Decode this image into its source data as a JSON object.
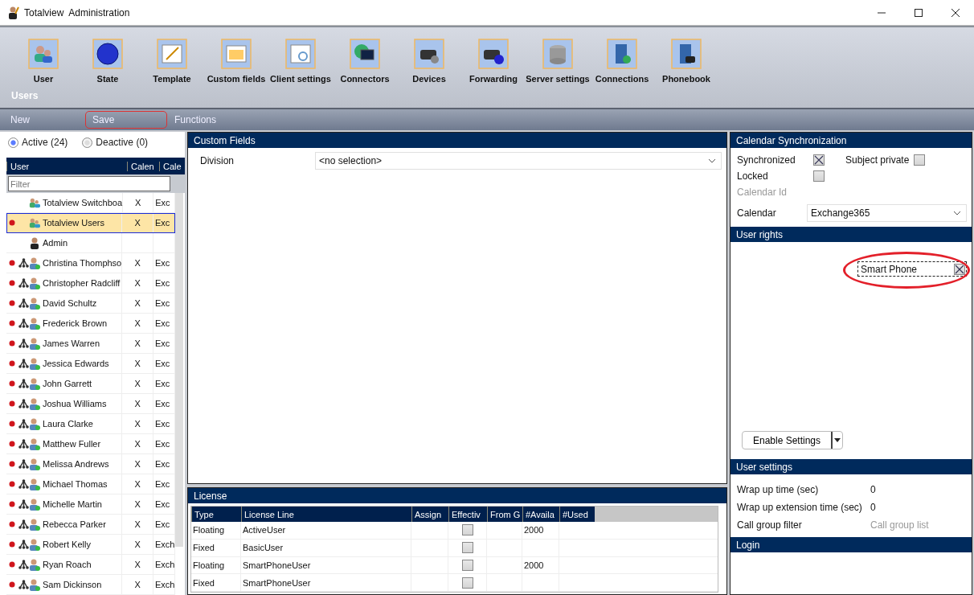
{
  "window": {
    "title": "Totalview  Administration"
  },
  "toolbar": {
    "items": [
      {
        "label": "User"
      },
      {
        "label": "State"
      },
      {
        "label": "Template"
      },
      {
        "label": "Custom fields"
      },
      {
        "label": "Client settings"
      },
      {
        "label": "Connectors"
      },
      {
        "label": "Devices"
      },
      {
        "label": "Forwarding"
      },
      {
        "label": "Server settings"
      },
      {
        "label": "Connections"
      },
      {
        "label": "Phonebook"
      }
    ],
    "section": "Users"
  },
  "commands": [
    {
      "label": "New",
      "annotated": false
    },
    {
      "label": "Save",
      "annotated": true
    },
    {
      "label": "Functions",
      "annotated": false
    }
  ],
  "filter_tabs": [
    {
      "label": "Active (24)",
      "selected": true
    },
    {
      "label": "Deactive (0)",
      "selected": false
    }
  ],
  "user_table": {
    "columns": [
      "User",
      "Calen",
      "Cale"
    ],
    "filter_placeholder": "Filter",
    "rows": [
      {
        "name": "Totalview Switchboa",
        "calendar": "X",
        "column_3": "Exc",
        "dot": false,
        "tree": false,
        "kind": "group",
        "selected": false
      },
      {
        "name": "Totalview Users",
        "calendar": "X",
        "column_3": "Exc",
        "dot": true,
        "tree": false,
        "kind": "group",
        "selected": true
      },
      {
        "name": "Admin",
        "calendar": "",
        "column_3": "",
        "dot": false,
        "tree": false,
        "kind": "admin",
        "selected": false
      },
      {
        "name": "Christina Thomphso",
        "calendar": "X",
        "column_3": "Exc",
        "dot": true,
        "tree": true,
        "kind": "user",
        "selected": false
      },
      {
        "name": "Christopher Radcliff",
        "calendar": "X",
        "column_3": "Exc",
        "dot": true,
        "tree": true,
        "kind": "user",
        "selected": false
      },
      {
        "name": "David Schultz",
        "calendar": "X",
        "column_3": "Exc",
        "dot": true,
        "tree": true,
        "kind": "user",
        "selected": false
      },
      {
        "name": "Frederick Brown",
        "calendar": "X",
        "column_3": "Exc",
        "dot": true,
        "tree": true,
        "kind": "user",
        "selected": false
      },
      {
        "name": "James Warren",
        "calendar": "X",
        "column_3": "Exc",
        "dot": true,
        "tree": true,
        "kind": "user",
        "selected": false
      },
      {
        "name": "Jessica Edwards",
        "calendar": "X",
        "column_3": "Exc",
        "dot": true,
        "tree": true,
        "kind": "user",
        "selected": false
      },
      {
        "name": "John Garrett",
        "calendar": "X",
        "column_3": "Exc",
        "dot": true,
        "tree": true,
        "kind": "user",
        "selected": false
      },
      {
        "name": "Joshua Williams",
        "calendar": "X",
        "column_3": "Exc",
        "dot": true,
        "tree": true,
        "kind": "user",
        "selected": false
      },
      {
        "name": "Laura Clarke",
        "calendar": "X",
        "column_3": "Exc",
        "dot": true,
        "tree": true,
        "kind": "user",
        "selected": false
      },
      {
        "name": "Matthew Fuller",
        "calendar": "X",
        "column_3": "Exc",
        "dot": true,
        "tree": true,
        "kind": "user",
        "selected": false
      },
      {
        "name": "Melissa Andrews",
        "calendar": "X",
        "column_3": "Exc",
        "dot": true,
        "tree": true,
        "kind": "user",
        "selected": false
      },
      {
        "name": "Michael Thomas",
        "calendar": "X",
        "column_3": "Exc",
        "dot": true,
        "tree": true,
        "kind": "user",
        "selected": false
      },
      {
        "name": "Michelle Martin",
        "calendar": "X",
        "column_3": "Exc",
        "dot": true,
        "tree": true,
        "kind": "user",
        "selected": false
      },
      {
        "name": "Rebecca Parker",
        "calendar": "X",
        "column_3": "Exc",
        "dot": true,
        "tree": true,
        "kind": "user",
        "selected": false
      },
      {
        "name": "Robert Kelly",
        "calendar": "X",
        "column_3": "Exch",
        "dot": true,
        "tree": true,
        "kind": "user",
        "selected": false
      },
      {
        "name": "Ryan Roach",
        "calendar": "X",
        "column_3": "Exch",
        "dot": true,
        "tree": true,
        "kind": "user",
        "selected": false
      },
      {
        "name": "Sam Dickinson",
        "calendar": "X",
        "column_3": "Exch",
        "dot": true,
        "tree": true,
        "kind": "user",
        "selected": false
      }
    ]
  },
  "custom_fields": {
    "title": "Custom Fields",
    "fields": [
      {
        "label": "Division",
        "value": "<no selection>"
      }
    ]
  },
  "license": {
    "title": "License",
    "columns": [
      "Type",
      "License Line",
      "Assign",
      "Effectiv",
      "From G",
      "#Availa",
      "#Used"
    ],
    "rows": [
      {
        "type": "Floating",
        "line": "ActiveUser",
        "effective": false,
        "available": "2000"
      },
      {
        "type": "Fixed",
        "line": "BasicUser",
        "effective": false,
        "available": ""
      },
      {
        "type": "Floating",
        "line": "SmartPhoneUser",
        "effective": false,
        "available": "2000"
      },
      {
        "type": "Fixed",
        "line": "SmartPhoneUser",
        "effective": false,
        "available": ""
      }
    ]
  },
  "calendar_sync": {
    "title": "Calendar Synchronization",
    "synchronized": {
      "label": "Synchronized",
      "checked": true
    },
    "subject_private": {
      "label": "Subject private",
      "checked": false
    },
    "locked": {
      "label": "Locked",
      "checked": false
    },
    "calendar_id": {
      "label": "Calendar Id"
    },
    "calendar": {
      "label": "Calendar",
      "value": "Exchange365"
    }
  },
  "user_rights": {
    "title": "User rights",
    "items": [
      {
        "label": "Smart Phone",
        "checked": true,
        "annotated": true
      }
    ],
    "button": "Enable Settings"
  },
  "user_settings": {
    "title": "User settings",
    "rows": [
      {
        "label": "Wrap up time (sec)",
        "value": "0",
        "disabled": false
      },
      {
        "label": "Wrap up extension time (sec)",
        "value": "0",
        "disabled": false
      },
      {
        "label": "Call group filter",
        "value": "Call group list",
        "disabled": true
      }
    ]
  },
  "login": {
    "title": "Login"
  }
}
